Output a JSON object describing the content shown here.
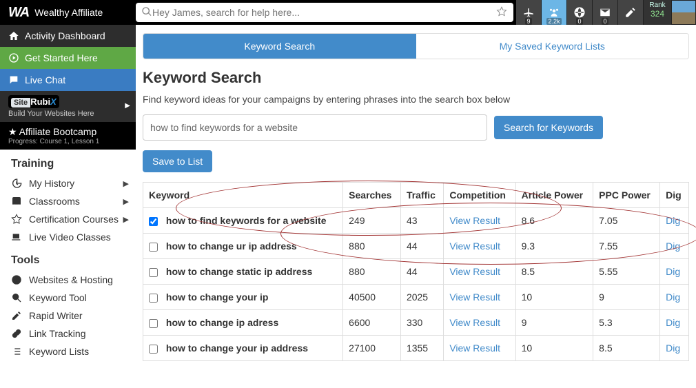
{
  "brand": "Wealthy Affiliate",
  "search": {
    "placeholder": "Hey James, search for help here..."
  },
  "topiconBadges": {
    "airplane": "9",
    "network": "2.2k",
    "globe": "0",
    "mail": "0",
    "pen": ""
  },
  "rank": {
    "label": "Rank",
    "value": "324"
  },
  "nav": {
    "dashboard": "Activity Dashboard",
    "get_started": "Get Started Here",
    "live_chat": "Live Chat",
    "siterubix_sub": "Build Your Websites Here",
    "bootcamp": "Affiliate Bootcamp",
    "bootcamp_sub": "Progress: Course 1, Lesson 1"
  },
  "sections": {
    "training": "Training",
    "tools": "Tools",
    "training_items": [
      "My History",
      "Classrooms",
      "Certification Courses",
      "Live Video Classes"
    ],
    "tools_items": [
      "Websites & Hosting",
      "Keyword Tool",
      "Rapid Writer",
      "Link Tracking",
      "Keyword Lists"
    ]
  },
  "tabs": {
    "search": "Keyword Search",
    "saved": "My Saved Keyword Lists"
  },
  "page": {
    "title": "Keyword Search",
    "lead": "Find keyword ideas for your campaigns by entering phrases into the search box below",
    "input_value": "how to find keywords for a website",
    "search_btn": "Search for Keywords",
    "save_btn": "Save to List"
  },
  "table": {
    "headers": [
      "Keyword",
      "Searches",
      "Traffic",
      "Competition",
      "Article Power",
      "PPC Power",
      "Dig"
    ],
    "view_result": "View Result",
    "dig": "Dig",
    "rows": [
      {
        "checked": true,
        "kw": "how to find keywords for a website",
        "searches": "249",
        "traffic": "43",
        "ap": "8.6",
        "ppc": "7.05"
      },
      {
        "checked": false,
        "kw": "how to change ur ip address",
        "searches": "880",
        "traffic": "44",
        "ap": "9.3",
        "ppc": "7.55"
      },
      {
        "checked": false,
        "kw": "how to change static ip address",
        "searches": "880",
        "traffic": "44",
        "ap": "8.5",
        "ppc": "5.55"
      },
      {
        "checked": false,
        "kw": "how to change your ip",
        "searches": "40500",
        "traffic": "2025",
        "ap": "10",
        "ppc": "9"
      },
      {
        "checked": false,
        "kw": "how to change ip adress",
        "searches": "6600",
        "traffic": "330",
        "ap": "9",
        "ppc": "5.3"
      },
      {
        "checked": false,
        "kw": "how to change your ip address",
        "searches": "27100",
        "traffic": "1355",
        "ap": "10",
        "ppc": "8.5"
      }
    ]
  }
}
